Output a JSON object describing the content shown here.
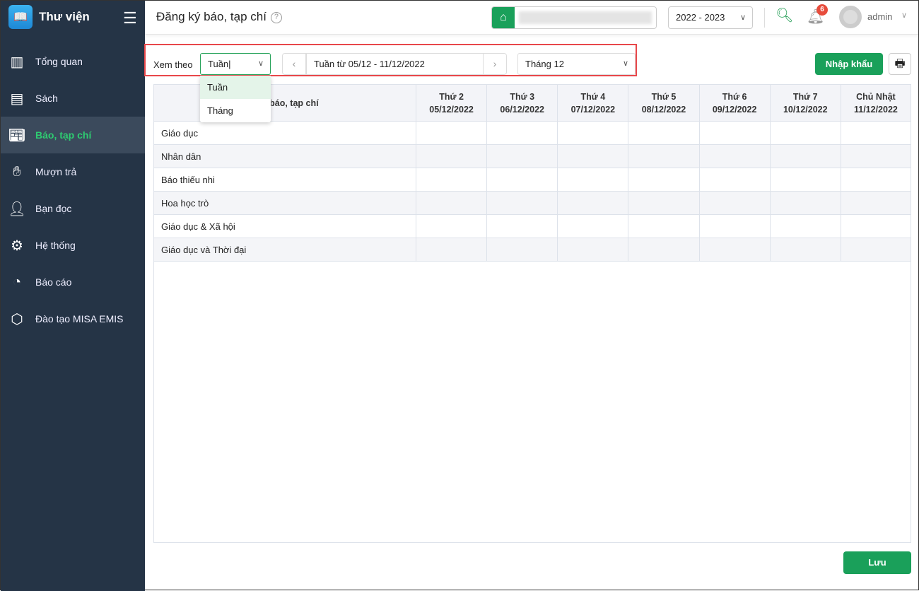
{
  "app": {
    "name": "Thư viện"
  },
  "sidebar": {
    "items": [
      {
        "label": "Tổng quan",
        "icon": "chart-bars-icon"
      },
      {
        "label": "Sách",
        "icon": "book-icon"
      },
      {
        "label": "Báo, tạp chí",
        "icon": "newspaper-icon",
        "active": true
      },
      {
        "label": "Mượn trả",
        "icon": "borrow-icon"
      },
      {
        "label": "Bạn đọc",
        "icon": "reader-icon"
      },
      {
        "label": "Hệ thống",
        "icon": "gear-icon"
      },
      {
        "label": "Báo cáo",
        "icon": "pie-chart-icon"
      },
      {
        "label": "Đào tạo MISA EMIS",
        "icon": "box-icon"
      }
    ]
  },
  "header": {
    "title": "Đăng ký báo, tạp chí",
    "school_year": "2022 - 2023",
    "notification_count": "6",
    "user": "admin"
  },
  "filters": {
    "view_label": "Xem theo",
    "view_value": "Tuần",
    "week_range": "Tuần từ 05/12 - 11/12/2022",
    "month": "Tháng 12",
    "options": [
      "Tuần",
      "Tháng"
    ]
  },
  "actions": {
    "import": "Nhập khẩu",
    "save": "Lưu"
  },
  "table": {
    "name_header": "Tên báo, tạp chí",
    "days": [
      {
        "day": "Thứ 2",
        "date": "05/12/2022"
      },
      {
        "day": "Thứ 3",
        "date": "06/12/2022"
      },
      {
        "day": "Thứ 4",
        "date": "07/12/2022"
      },
      {
        "day": "Thứ 5",
        "date": "08/12/2022"
      },
      {
        "day": "Thứ 6",
        "date": "09/12/2022"
      },
      {
        "day": "Thứ 7",
        "date": "10/12/2022"
      },
      {
        "day": "Chủ Nhật",
        "date": "11/12/2022"
      }
    ],
    "rows": [
      "Giáo dục",
      "Nhân dân",
      "Báo thiếu nhi",
      "Hoa học trò",
      "Giáo dục & Xã hội",
      "Giáo dục và Thời đại"
    ]
  },
  "colors": {
    "accent": "#1aa05a",
    "sidebar": "#253446",
    "highlight": "#e8474a"
  }
}
